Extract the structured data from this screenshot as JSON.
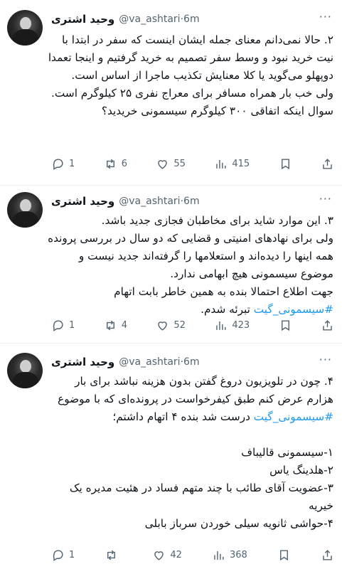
{
  "tweets": [
    {
      "name": "وحید اشتری",
      "handle": "@va_ashtari",
      "time": "6m",
      "more": "···",
      "text": "۲. حالا نمی‌دانم معنای جمله ایشان اینست که سفر در ابتدا با نیت خرید نبود و وسط سفر تصمیم به خرید گرفتیم و اینجا تعمدا دوپهلو می‌گوید یا کلا معنایش تکذیب ماجرا از اساس است.\nولی خب بار همراه مسافر برای معراج نفری ۲۵ کیلوگرم است.\nسوال اینکه اتفاقی ۳۰۰ کیلوگرم سیسمونی خریدید؟",
      "replies": "1",
      "retweets": "6",
      "likes": "55",
      "views": "415"
    },
    {
      "name": "وحید اشتری",
      "handle": "@va_ashtari",
      "time": "6m",
      "more": "···",
      "text_main": "۳. این موارد شاید برای مخاطبان فجازی جدید باشد.\nولی برای نهادهای امنیتی و قضایی که دو سال در بررسی پرونده همه اینها را دیده‌اند و استعلامها را گرفته‌اند جدید نیست و موضوع سیسمونی هیچ ابهامی ندارد.\nجهت اطلاع احتمالا بنده به همین خاطر بابت اتهام ",
      "hashtag": "#سیسمونی_گیت",
      "text_tail": " تبرئه شدم.",
      "replies": "1",
      "retweets": "4",
      "likes": "52",
      "views": "423"
    },
    {
      "name": "وحید اشتری",
      "handle": "@va_ashtari",
      "time": "6m",
      "more": "···",
      "text_head": "۴. چون در تلویزیون دروغ گفتن بدون هزینه نباشد برای بار هزارم عرض کنم طبق کیفرخواست در پرونده‌ای که با موضوع ",
      "hashtag": "#سیسمونی_گیت",
      "text_tail": " درست شد بنده ۴ اتهام داشتم؛\n\n۱-سیسمونی قالیباف\n۲-هلدینگ یاس\n۳-عضویت آقای طائب با چند متهم فساد در هئیت مدیره یک خیریه\n۴-حواشی ثانویه سیلی خوردن سرباز بابلی",
      "replies": "1",
      "retweets": "",
      "likes": "42",
      "views": "368"
    }
  ],
  "icons": [
    "reply-icon",
    "retweet-icon",
    "like-icon",
    "views-icon",
    "bookmark-icon",
    "share-icon"
  ],
  "colors": {
    "text": "#0f1419",
    "secondary": "#536471",
    "link": "#1d9bf0"
  }
}
